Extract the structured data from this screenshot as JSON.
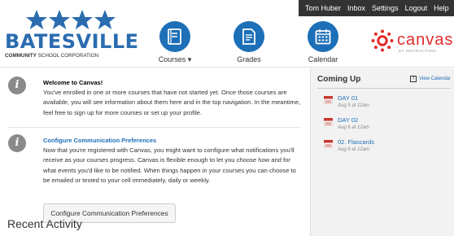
{
  "topnav": {
    "user": "Tom Huber",
    "inbox": "Inbox",
    "settings": "Settings",
    "logout": "Logout",
    "help": "Help"
  },
  "logo": {
    "name": "BATESVILLE",
    "sub_bold": "COMMUNITY",
    "sub_rest": " SCHOOL CORPORATION",
    "color": "#2b6cb0"
  },
  "nav": {
    "courses": "Courses ▾",
    "grades": "Grades",
    "calendar": "Calendar"
  },
  "canvas_logo": {
    "word": "canvas",
    "sub": "BY INSTRUCTURE",
    "color": "#e12a2a"
  },
  "alerts": [
    {
      "title": "Welcome to Canvas!",
      "text": "You've enrolled in one or more courses that have not started yet. Once those courses are available, you will see information about them here and in the top navigation. In the meantime, feel free to sign up for more courses or set up your profile."
    },
    {
      "title": "Configure Communication Preferences",
      "text": "Now that you're registered with Canvas, you might want to configure what notifications you'll receive as your courses progress. Canvas is flexible enough to let you choose how and for what events you'd like to be notified. When things happen in your courses you can choose to be emailed or texted to your cell immediately, daily or weekly.",
      "button": "Configure Communication Preferences"
    }
  ],
  "recent_activity": "Recent Activity",
  "coming_up": {
    "title": "Coming Up",
    "view_calendar": "View Calendar",
    "events": [
      {
        "title": "DAY 01",
        "date": "Aug 5 at 12am"
      },
      {
        "title": "DAY 02",
        "date": "Aug 6 at 12am"
      },
      {
        "title": "02. Flascards",
        "date": "Aug 6 at 12am"
      }
    ]
  },
  "colors": {
    "accent": "#1d6fb8",
    "topbar": "#333333",
    "event_icon": "#c8372d"
  }
}
